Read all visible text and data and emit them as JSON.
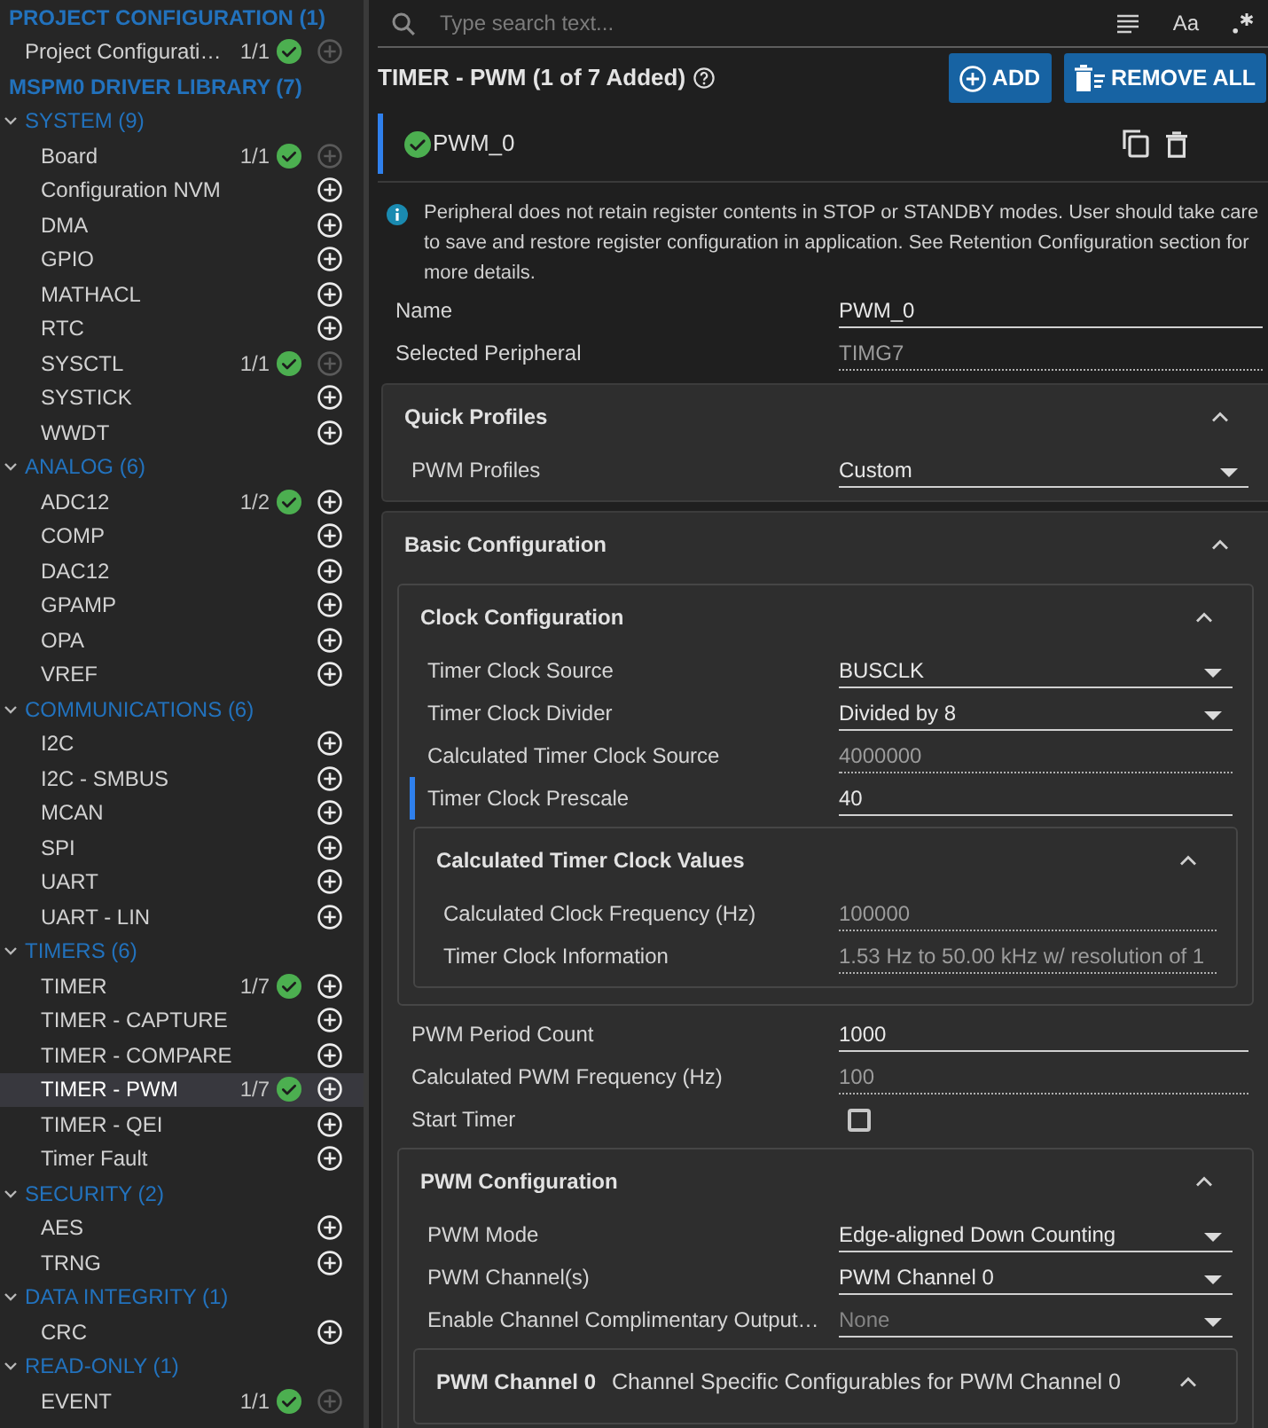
{
  "sidebar": {
    "tree": [
      {
        "kind": "heading",
        "label": "PROJECT CONFIGURATION (1)",
        "children": [
          {
            "kind": "item",
            "label": "Project Configurati…",
            "count": "1/1",
            "configured": true,
            "addable": false,
            "selected": false
          }
        ]
      },
      {
        "kind": "heading",
        "label": "MSPM0 DRIVER LIBRARY (7)",
        "children": [
          {
            "kind": "group",
            "label": "SYSTEM (9)",
            "expanded": true,
            "children": [
              {
                "kind": "item",
                "label": "Board",
                "count": "1/1",
                "configured": true,
                "addable": false,
                "selected": false
              },
              {
                "kind": "item",
                "label": "Configuration NVM",
                "configured": false,
                "addable": true,
                "selected": false
              },
              {
                "kind": "item",
                "label": "DMA",
                "configured": false,
                "addable": true,
                "selected": false
              },
              {
                "kind": "item",
                "label": "GPIO",
                "configured": false,
                "addable": true,
                "selected": false
              },
              {
                "kind": "item",
                "label": "MATHACL",
                "configured": false,
                "addable": true,
                "selected": false
              },
              {
                "kind": "item",
                "label": "RTC",
                "configured": false,
                "addable": true,
                "selected": false
              },
              {
                "kind": "item",
                "label": "SYSCTL",
                "count": "1/1",
                "configured": true,
                "addable": false,
                "selected": false
              },
              {
                "kind": "item",
                "label": "SYSTICK",
                "configured": false,
                "addable": true,
                "selected": false
              },
              {
                "kind": "item",
                "label": "WWDT",
                "configured": false,
                "addable": true,
                "selected": false
              }
            ]
          },
          {
            "kind": "group",
            "label": "ANALOG (6)",
            "expanded": true,
            "children": [
              {
                "kind": "item",
                "label": "ADC12",
                "count": "1/2",
                "configured": true,
                "addable": true,
                "selected": false
              },
              {
                "kind": "item",
                "label": "COMP",
                "configured": false,
                "addable": true,
                "selected": false
              },
              {
                "kind": "item",
                "label": "DAC12",
                "configured": false,
                "addable": true,
                "selected": false
              },
              {
                "kind": "item",
                "label": "GPAMP",
                "configured": false,
                "addable": true,
                "selected": false
              },
              {
                "kind": "item",
                "label": "OPA",
                "configured": false,
                "addable": true,
                "selected": false
              },
              {
                "kind": "item",
                "label": "VREF",
                "configured": false,
                "addable": true,
                "selected": false
              }
            ]
          },
          {
            "kind": "group",
            "label": "COMMUNICATIONS (6)",
            "expanded": true,
            "children": [
              {
                "kind": "item",
                "label": "I2C",
                "configured": false,
                "addable": true,
                "selected": false
              },
              {
                "kind": "item",
                "label": "I2C - SMBUS",
                "configured": false,
                "addable": true,
                "selected": false
              },
              {
                "kind": "item",
                "label": "MCAN",
                "configured": false,
                "addable": true,
                "selected": false
              },
              {
                "kind": "item",
                "label": "SPI",
                "configured": false,
                "addable": true,
                "selected": false
              },
              {
                "kind": "item",
                "label": "UART",
                "configured": false,
                "addable": true,
                "selected": false
              },
              {
                "kind": "item",
                "label": "UART - LIN",
                "configured": false,
                "addable": true,
                "selected": false
              }
            ]
          },
          {
            "kind": "group",
            "label": "TIMERS (6)",
            "expanded": true,
            "children": [
              {
                "kind": "item",
                "label": "TIMER",
                "count": "1/7",
                "configured": true,
                "addable": true,
                "selected": false
              },
              {
                "kind": "item",
                "label": "TIMER - CAPTURE",
                "configured": false,
                "addable": true,
                "selected": false
              },
              {
                "kind": "item",
                "label": "TIMER - COMPARE",
                "configured": false,
                "addable": true,
                "selected": false
              },
              {
                "kind": "item",
                "label": "TIMER - PWM",
                "count": "1/7",
                "configured": true,
                "addable": true,
                "selected": true
              },
              {
                "kind": "item",
                "label": "TIMER - QEI",
                "configured": false,
                "addable": true,
                "selected": false
              },
              {
                "kind": "item",
                "label": "Timer Fault",
                "configured": false,
                "addable": true,
                "selected": false
              }
            ]
          },
          {
            "kind": "group",
            "label": "SECURITY (2)",
            "expanded": true,
            "children": [
              {
                "kind": "item",
                "label": "AES",
                "configured": false,
                "addable": true,
                "selected": false
              },
              {
                "kind": "item",
                "label": "TRNG",
                "configured": false,
                "addable": true,
                "selected": false
              }
            ]
          },
          {
            "kind": "group",
            "label": "DATA INTEGRITY (1)",
            "expanded": true,
            "children": [
              {
                "kind": "item",
                "label": "CRC",
                "configured": false,
                "addable": true,
                "selected": false
              }
            ]
          },
          {
            "kind": "group",
            "label": "READ-ONLY (1)",
            "expanded": true,
            "children": [
              {
                "kind": "item",
                "label": "EVENT",
                "count": "1/1",
                "configured": true,
                "addable": false,
                "selected": false
              }
            ]
          }
        ]
      }
    ]
  },
  "search": {
    "placeholder": "Type search text...",
    "case_toggle": "Aa"
  },
  "module": {
    "title": "TIMER - PWM (1 of 7 Added)",
    "buttons": [
      {
        "kind": "add",
        "label": "ADD"
      },
      {
        "kind": "remove_all",
        "label": "REMOVE ALL"
      }
    ]
  },
  "instances": [
    {
      "name": "PWM_0",
      "selected": true,
      "valid": true
    }
  ],
  "notice": "Peripheral does not retain register contents in STOP or STANDBY modes. User should take care to save and restore register configuration in application. See Retention Configuration section for more details.",
  "config": [
    {
      "kind": "text",
      "label": "Name",
      "value": "PWM_0",
      "modified": false
    },
    {
      "kind": "readonly",
      "label": "Selected Peripheral",
      "value": "TIMG7",
      "modified": false
    },
    {
      "kind": "section",
      "title": "Quick Profiles",
      "expanded": true,
      "children": [
        {
          "kind": "select",
          "label": "PWM Profiles",
          "value": "Custom",
          "modified": false
        }
      ]
    },
    {
      "kind": "section",
      "title": "Basic Configuration",
      "expanded": true,
      "children": [
        {
          "kind": "section",
          "title": "Clock Configuration",
          "expanded": true,
          "children": [
            {
              "kind": "select",
              "label": "Timer Clock Source",
              "value": "BUSCLK",
              "modified": false
            },
            {
              "kind": "select",
              "label": "Timer Clock Divider",
              "value": "Divided by 8",
              "modified": false
            },
            {
              "kind": "readonly",
              "label": "Calculated Timer Clock Source",
              "value": "4000000",
              "modified": false
            },
            {
              "kind": "text",
              "label": "Timer Clock Prescale",
              "value": "40",
              "modified": true
            },
            {
              "kind": "section",
              "title": "Calculated Timer Clock Values",
              "expanded": true,
              "children": [
                {
                  "kind": "readonly",
                  "label": "Calculated Clock Frequency (Hz)",
                  "value": "100000",
                  "modified": false
                },
                {
                  "kind": "readonly",
                  "label": "Timer Clock Information",
                  "value": "1.53 Hz to 50.00 kHz w/ resolution of 1",
                  "modified": false
                }
              ]
            }
          ]
        },
        {
          "kind": "text",
          "label": "PWM Period Count",
          "value": "1000",
          "modified": false
        },
        {
          "kind": "readonly",
          "label": "Calculated PWM Frequency (Hz)",
          "value": "100",
          "modified": false
        },
        {
          "kind": "checkbox",
          "label": "Start Timer",
          "checked": false,
          "modified": false
        },
        {
          "kind": "section",
          "title": "PWM Configuration",
          "expanded": true,
          "children": [
            {
              "kind": "select",
              "label": "PWM Mode",
              "value": "Edge-aligned Down Counting",
              "modified": false
            },
            {
              "kind": "select",
              "label": "PWM Channel(s)",
              "value": "PWM Channel 0",
              "modified": false
            },
            {
              "kind": "select",
              "label": "Enable Channel Complimentary Output…",
              "placeholder": "None",
              "modified": false
            },
            {
              "kind": "section",
              "title": "PWM Channel 0",
              "subtitle": "Channel Specific Configurables for PWM Channel 0",
              "expanded": true
            }
          ]
        }
      ]
    }
  ]
}
